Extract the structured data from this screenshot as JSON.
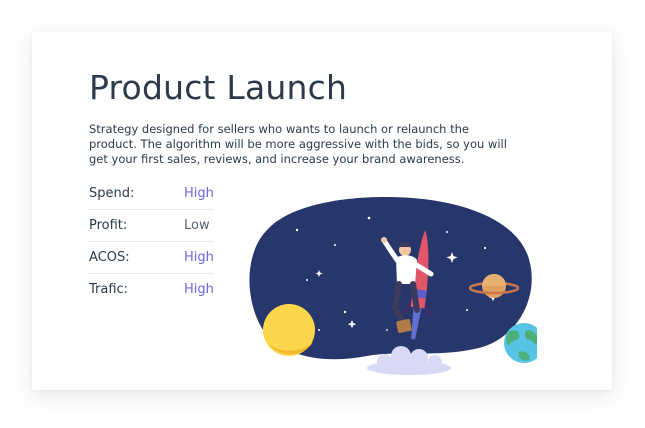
{
  "title": "Product Launch",
  "description": "Strategy designed for sellers who wants to launch or relaunch the product. The algorithm will be more aggressive with the bids, so you will get your first sales, reviews, and increase your brand awareness.",
  "metrics": [
    {
      "label": "Spend:",
      "value": "High"
    },
    {
      "label": "Profit:",
      "value": "Low"
    },
    {
      "label": "ACOS:",
      "value": "High"
    },
    {
      "label": "Trafic:",
      "value": "High"
    }
  ],
  "colors": {
    "text": "#2d3a4a",
    "accent": "#6d63e2",
    "neutral_value": "#5a6270",
    "space_bg": "#28376b",
    "sun": "#fcd64a",
    "planet": "#e0a060",
    "earth_ocean": "#57c4e5",
    "earth_land": "#4caf7a"
  }
}
